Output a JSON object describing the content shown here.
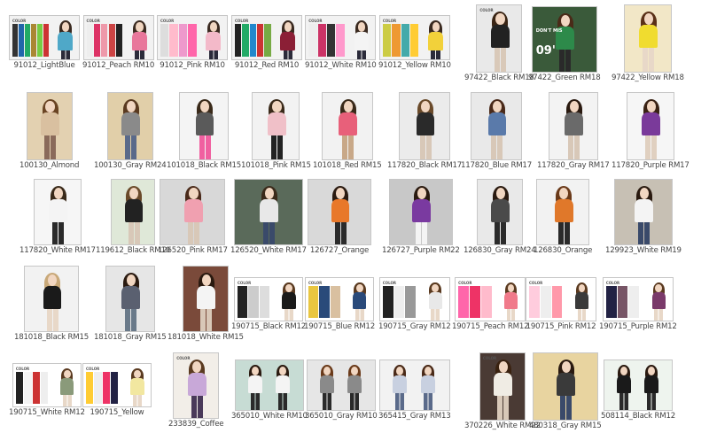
{
  "items": [
    {
      "caption": "91012_LightBlue"
    },
    {
      "caption": "91012_Peach RM10"
    },
    {
      "caption": "91012_Pink RM10"
    },
    {
      "caption": "91012_Red RM10"
    },
    {
      "caption": "91012_White RM10"
    },
    {
      "caption": "91012_Yellow RM10"
    },
    {
      "caption": "97422_Black RM18"
    },
    {
      "caption": "97422_Green RM18"
    },
    {
      "caption": "97422_Yellow RM18"
    },
    {
      "caption": "100130_Almond"
    },
    {
      "caption": "100130_Gray RM24"
    },
    {
      "caption": "101018_Black RM15"
    },
    {
      "caption": "101018_Pink RM15"
    },
    {
      "caption": "101018_Red RM15"
    },
    {
      "caption": "117820_Black RM17"
    },
    {
      "caption": "117820_Blue RM17"
    },
    {
      "caption": "117820_Gray RM17"
    },
    {
      "caption": "117820_Purple RM17"
    },
    {
      "caption": "117820_White RM17"
    },
    {
      "caption": "119612_Black RM10"
    },
    {
      "caption": "126520_Pink RM17"
    },
    {
      "caption": "126520_White RM17"
    },
    {
      "caption": "126727_Orange"
    },
    {
      "caption": "126727_Purple RM22"
    },
    {
      "caption": "126830_Gray RM24"
    },
    {
      "caption": "126830_Orange"
    },
    {
      "caption": "129923_White RM19"
    },
    {
      "caption": "181018_Black RM15"
    },
    {
      "caption": "181018_Gray RM15"
    },
    {
      "caption": "181018_White RM15"
    },
    {
      "caption": "190715_Black RM12"
    },
    {
      "caption": "190715_Blue RM12"
    },
    {
      "caption": "190715_Gray RM12"
    },
    {
      "caption": "190715_Peach RM12"
    },
    {
      "caption": "190715_Pink RM12"
    },
    {
      "caption": "190715_Purple RM12"
    },
    {
      "caption": "190715_White RM12"
    },
    {
      "caption": "190715_Yellow"
    },
    {
      "caption": "233839_Coffee"
    },
    {
      "caption": "365010_White RM10"
    },
    {
      "caption": "365010_Gray RM10"
    },
    {
      "caption": "365415_Gray RM13"
    },
    {
      "caption": "370226_White RM22"
    },
    {
      "caption": "480318_Gray RM15"
    },
    {
      "caption": "508114_Black RM12"
    }
  ],
  "image_text": {
    "color_banner": "COLOR",
    "97422_green_overlay_line1": "DON'T MIS",
    "97422_green_overlay_line2": "09'",
    "233839_banner": "COLOR",
    "370226_banner": "COLOR",
    "97422_black_banner": "COLOR"
  }
}
